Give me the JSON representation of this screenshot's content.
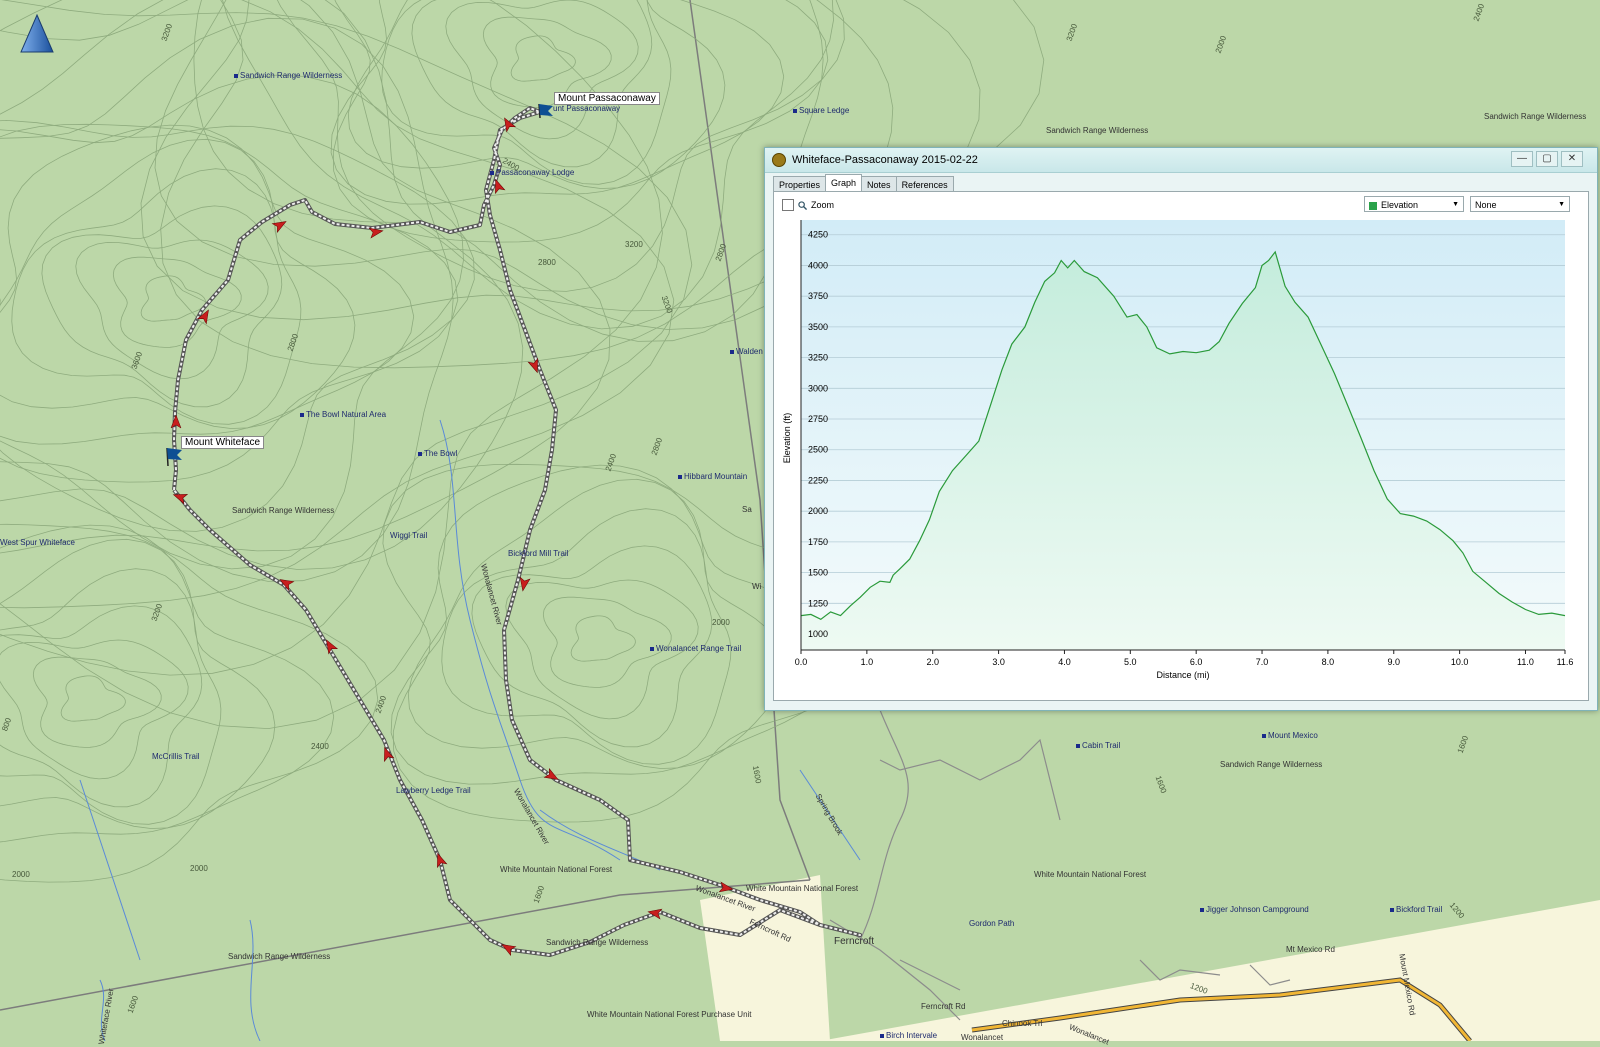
{
  "window": {
    "title": "Whiteface-Passaconaway 2015-02-22",
    "tabs": [
      "Properties",
      "Graph",
      "Notes",
      "References"
    ],
    "active_tab": "Graph",
    "zoom_label": "Zoom",
    "primary_series_select": "Elevation",
    "secondary_series_select": "None",
    "buttons": {
      "minimize": "—",
      "restore": "▢",
      "close": "✕"
    }
  },
  "chart_data": {
    "type": "line",
    "xlabel": "Distance (mi)",
    "ylabel": "Elevation (ft)",
    "xlim": [
      0,
      11.6
    ],
    "ylim": [
      870,
      4370
    ],
    "x_ticks": [
      "0.0",
      "1.0",
      "2.0",
      "3.0",
      "4.0",
      "5.0",
      "6.0",
      "7.0",
      "8.0",
      "9.0",
      "10.0",
      "11.0",
      "11.6"
    ],
    "x_tick_values": [
      0,
      1,
      2,
      3,
      4,
      5,
      6,
      7,
      8,
      9,
      10,
      11,
      11.6
    ],
    "y_ticks": [
      1000,
      1250,
      1500,
      1750,
      2000,
      2250,
      2500,
      2750,
      3000,
      3250,
      3500,
      3750,
      4000,
      4250
    ],
    "grid": true,
    "color": "#2a9a3a",
    "series": [
      {
        "x": [
          0,
          0.15,
          0.3,
          0.45,
          0.6,
          0.75,
          0.9,
          1.05,
          1.2,
          1.35,
          1.4,
          1.5,
          1.65,
          1.8,
          1.95,
          2.1,
          2.3,
          2.5,
          2.7,
          2.9,
          3.05,
          3.2,
          3.4,
          3.55,
          3.7,
          3.85,
          3.95,
          4.05,
          4.15,
          4.3,
          4.5,
          4.75,
          4.95,
          5.1,
          5.25,
          5.4,
          5.6,
          5.8,
          6.0,
          6.2,
          6.35,
          6.5,
          6.7,
          6.9,
          7.0,
          7.1,
          7.2,
          7.35,
          7.5,
          7.7,
          7.9,
          8.1,
          8.3,
          8.5,
          8.7,
          8.9,
          9.1,
          9.3,
          9.5,
          9.7,
          9.9,
          10.05,
          10.2,
          10.4,
          10.6,
          10.8,
          11.0,
          11.2,
          11.4,
          11.6
        ],
        "y": [
          1150,
          1160,
          1120,
          1180,
          1150,
          1230,
          1300,
          1380,
          1430,
          1420,
          1480,
          1530,
          1610,
          1760,
          1930,
          2160,
          2330,
          2450,
          2570,
          2900,
          3150,
          3360,
          3500,
          3700,
          3870,
          3940,
          4040,
          3980,
          4040,
          3950,
          3900,
          3750,
          3580,
          3600,
          3500,
          3330,
          3280,
          3300,
          3290,
          3310,
          3380,
          3530,
          3690,
          3820,
          4000,
          4040,
          4110,
          3830,
          3700,
          3580,
          3350,
          3120,
          2860,
          2600,
          2330,
          2100,
          1980,
          1960,
          1920,
          1850,
          1760,
          1660,
          1510,
          1420,
          1330,
          1260,
          1200,
          1160,
          1170,
          1150
        ]
      }
    ]
  },
  "map": {
    "waypoints": [
      "Mount Passaconaway",
      "Mount Whiteface"
    ],
    "labels_blue": [
      "Sandwich Range Wilderness",
      "Square Ledge",
      "Sandwich Range Wilderness",
      "Sandwich Range Wilderness",
      "unt Passaconaway",
      "Passaconaway Lodge",
      "The Bowl Natural Area",
      "The Bowl",
      "Walden Tr",
      "Hibbard Mountain",
      "West Spur Whiteface",
      "Wiggl Trail",
      "Bickford Mill Trail",
      "Wonalancet Range Trail",
      "McCrillis Trail",
      "Lawberry Ledge Trail",
      "Cabin Trail",
      "Mount Mexico",
      "Gordon Path",
      "Jigger Johnson Campground",
      "Bickford Trail",
      "Birch Intervale"
    ],
    "labels_dark": [
      "Sandwich Range Wilderness",
      "White Mountain National Forest",
      "White Mountain National Forest",
      "White Mountain National Forest",
      "Sandwich Range Wilderness",
      "Sandwich Range Wilderness",
      "White Mountain National Forest Purchase Unit",
      "Wonalancet River",
      "Wonalancet River",
      "Mt Mexico Rd",
      "Ferncroft",
      "Ferncroft Rd",
      "Chinook Trl",
      "Wonalancet",
      "Mount Mexico Rd",
      "Spring Brook",
      "Whiteface River",
      "Sandwich Range Wilderness",
      "Wonalancet",
      "Ferncroft Rd",
      "Wonalancet River",
      "Sandwich Range Wilderness",
      "Wi",
      "Sa"
    ],
    "contour_labels": [
      "3200",
      "3200",
      "3600",
      "2800",
      "2800",
      "3200",
      "2800",
      "3200",
      "2400",
      "2400",
      "2400",
      "2000",
      "2000",
      "2000",
      "2000",
      "3200",
      "1600",
      "1600",
      "1600",
      "1600",
      "1200",
      "1200",
      "2800",
      "2400",
      "3600",
      "800",
      "2400",
      "2000",
      "1600"
    ]
  }
}
